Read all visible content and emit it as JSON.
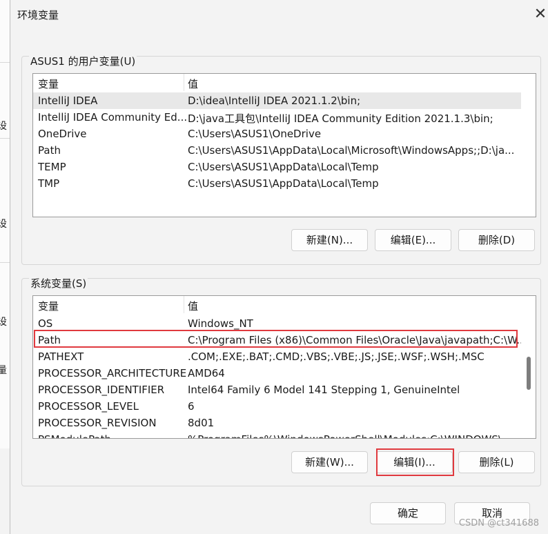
{
  "window": {
    "title": "环境变量",
    "close_glyph": "✕"
  },
  "background_window": {
    "fragments": [
      "设",
      "设",
      "设",
      "量"
    ]
  },
  "user_vars": {
    "group_label": "ASUS1 的用户变量(U)",
    "columns": [
      "变量",
      "值"
    ],
    "rows": [
      {
        "name": "IntelliJ IDEA",
        "value": "D:\\idea\\IntelliJ IDEA 2021.1.2\\bin;"
      },
      {
        "name": "IntelliJ IDEA Community Ed...",
        "value": "D:\\java工具包\\IntelliJ IDEA Community Edition 2021.1.3\\bin;"
      },
      {
        "name": "OneDrive",
        "value": "C:\\Users\\ASUS1\\OneDrive"
      },
      {
        "name": "Path",
        "value": "C:\\Users\\ASUS1\\AppData\\Local\\Microsoft\\WindowsApps;;D:\\ja..."
      },
      {
        "name": "TEMP",
        "value": "C:\\Users\\ASUS1\\AppData\\Local\\Temp"
      },
      {
        "name": "TMP",
        "value": "C:\\Users\\ASUS1\\AppData\\Local\\Temp"
      }
    ],
    "selected_index": 0,
    "buttons": {
      "new": "新建(N)...",
      "edit": "编辑(E)...",
      "delete": "删除(D)"
    }
  },
  "system_vars": {
    "group_label": "系统变量(S)",
    "columns": [
      "变量",
      "值"
    ],
    "rows": [
      {
        "name": "OS",
        "value": "Windows_NT"
      },
      {
        "name": "Path",
        "value": "C:\\Program Files (x86)\\Common Files\\Oracle\\Java\\javapath;C:\\W..."
      },
      {
        "name": "PATHEXT",
        "value": ".COM;.EXE;.BAT;.CMD;.VBS;.VBE;.JS;.JSE;.WSF;.WSH;.MSC"
      },
      {
        "name": "PROCESSOR_ARCHITECTURE",
        "value": "AMD64"
      },
      {
        "name": "PROCESSOR_IDENTIFIER",
        "value": "Intel64 Family 6 Model 141 Stepping 1, GenuineIntel"
      },
      {
        "name": "PROCESSOR_LEVEL",
        "value": "6"
      },
      {
        "name": "PROCESSOR_REVISION",
        "value": "8d01"
      },
      {
        "name": "PSModulePath",
        "value": "%ProgramFiles%\\WindowsPowerShell\\Modules;C:\\WINDOWS\\..."
      }
    ],
    "highlighted_index": 1,
    "buttons": {
      "new": "新建(W)...",
      "edit": "编辑(I)...",
      "delete": "删除(L)"
    }
  },
  "footer": {
    "ok": "确定",
    "cancel": "取消"
  },
  "watermark": "CSDN @ct341688",
  "colors": {
    "highlight_red": "#e0393e",
    "selected_row": "#e8e8e8"
  }
}
